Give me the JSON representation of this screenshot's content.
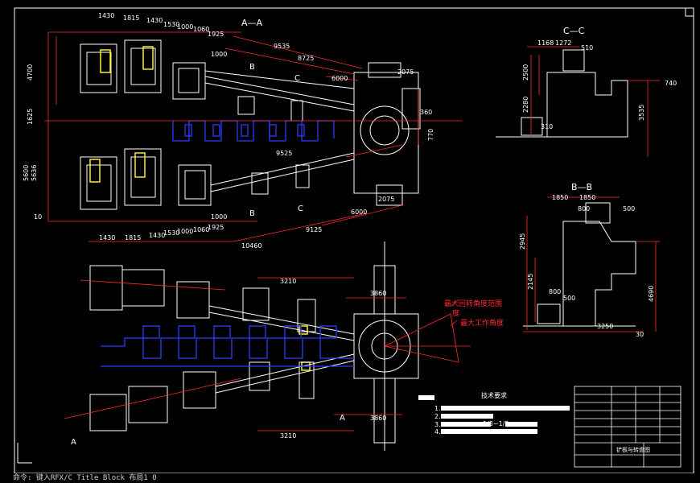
{
  "sections": {
    "aa": "A—A",
    "cc": "C—C",
    "bb": "B—B"
  },
  "section_markers": [
    "B",
    "C",
    "B",
    "C",
    "A",
    "A"
  ],
  "dims_top": [
    "1430",
    "1815",
    "1430",
    "1530",
    "1000",
    "1060",
    "1925",
    "1000",
    "9535",
    "8725",
    "6000",
    "2075",
    "360"
  ],
  "dims_left": [
    "4700",
    "1625",
    "5636",
    "5600",
    "10"
  ],
  "dims_lower": [
    "9525",
    "1430",
    "1815",
    "1430",
    "1530",
    "1000",
    "1060",
    "1925",
    "1000",
    "6000",
    "9125",
    "2075",
    "10460",
    "770"
  ],
  "dims_cc": [
    "1168",
    "1272",
    "510",
    "2500",
    "2280",
    "3535",
    "740",
    "310"
  ],
  "dims_bb": [
    "1850",
    "1850",
    "800",
    "500",
    "2945",
    "2145",
    "4690",
    "800",
    "500",
    "3250",
    "30"
  ],
  "dims_plan": [
    "3210",
    "3860",
    "3210",
    "3860"
  ],
  "callouts": {
    "rotate_top": "最大回转角度范围",
    "rotate_top2": "度",
    "work_angle": "最大工作角度"
  },
  "tech_req": {
    "title": "技术要求",
    "items": [
      "1.",
      "2.",
      "3.",
      "4."
    ],
    "mid_text": "1/3~1/2"
  },
  "title_block": {
    "name": "铲板与转盘图"
  },
  "command_line": "命令: 键入RFX/C Title Block 布局1 0",
  "colors": {
    "background": "#000000",
    "drawing_line": "#ffffff",
    "dimension": "#ff2a2a",
    "hidden": "#2a3cff",
    "text": "#ffffff",
    "highlight": "#ffee22"
  }
}
